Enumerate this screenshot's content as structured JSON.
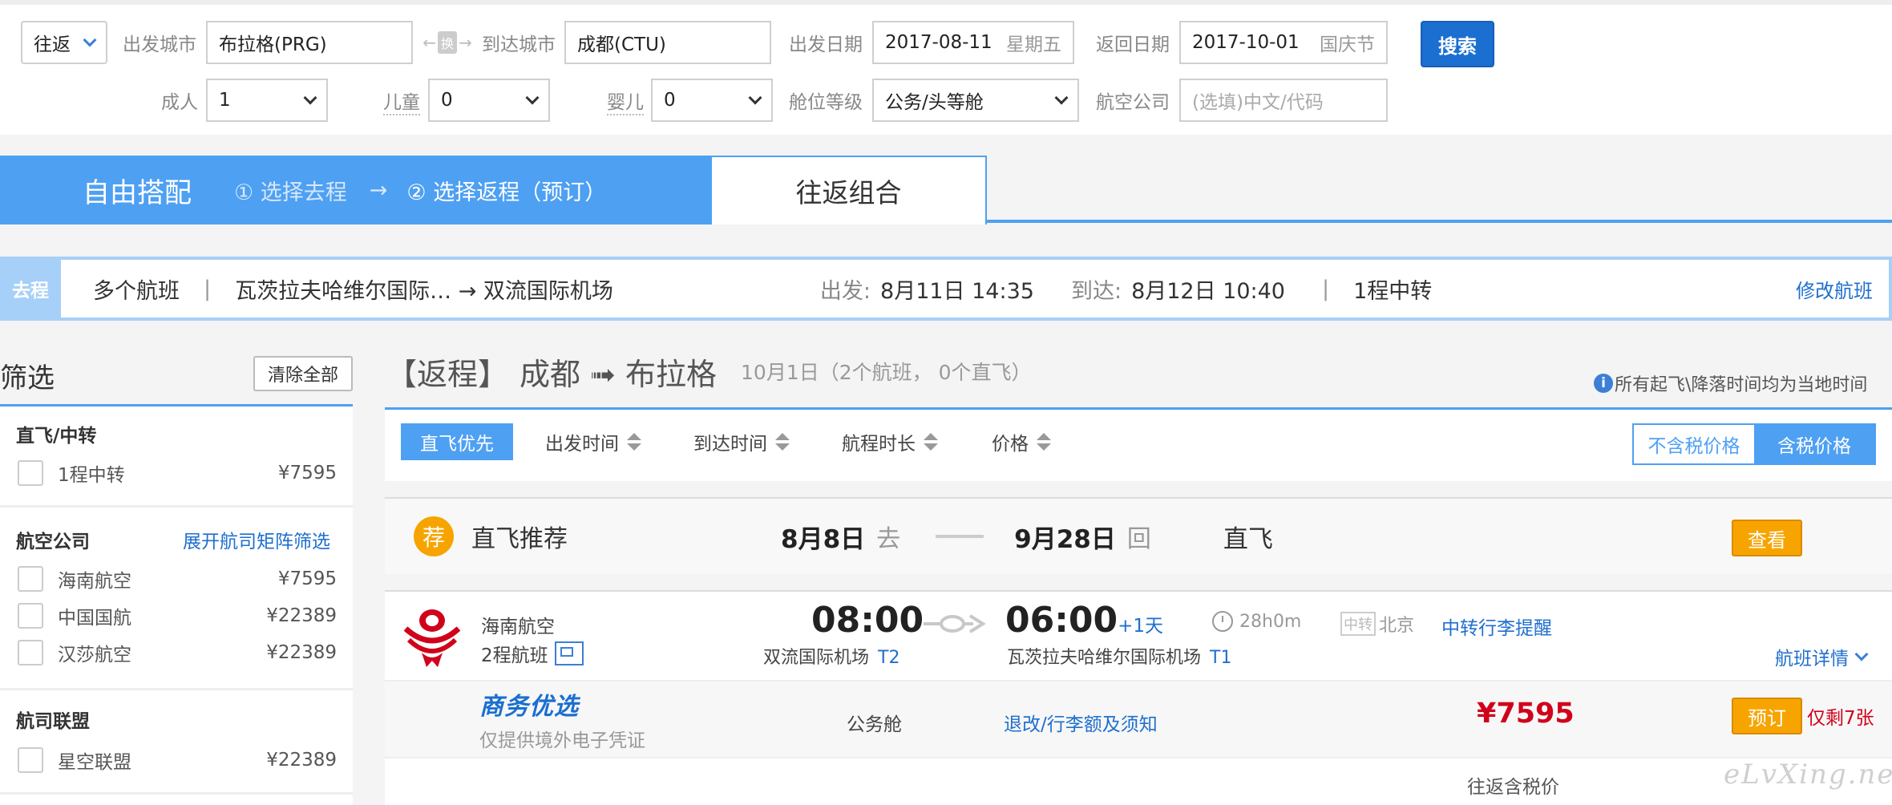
{
  "search": {
    "trip_type": "往返",
    "depart_city_label": "出发城市",
    "depart_city": "布拉格(PRG)",
    "swap": "换",
    "arrive_city_label": "到达城市",
    "arrive_city": "成都(CTU)",
    "depart_date_label": "出发日期",
    "depart_date": "2017-08-11",
    "depart_weekday": "星期五",
    "return_date_label": "返回日期",
    "return_date": "2017-10-01",
    "return_note": "国庆节",
    "search_button": "搜索",
    "adult_label": "成人",
    "adult_value": "1",
    "child_label": "儿童",
    "child_value": "0",
    "infant_label": "婴儿",
    "infant_value": "0",
    "cabin_label": "舱位等级",
    "cabin_value": "公务/头等舱",
    "airline_label": "航空公司",
    "airline_placeholder": "(选填)中文/代码"
  },
  "mode_tabs": {
    "free_combo": "自由搭配",
    "step1": "① 选择去程",
    "arrow": "→",
    "step2": "② 选择返程（预订）",
    "round_combo": "往返组合"
  },
  "outbound": {
    "tag": "去程",
    "flights": "多个航班",
    "sep": "|",
    "route": "瓦茨拉夫哈维尔国际… → 双流国际机场",
    "depart_label": "出发:",
    "depart_time": "8月11日 14:35",
    "arrive_label": "到达:",
    "arrive_time": "8月12日 10:40",
    "stops": "1程中转",
    "modify": "修改航班"
  },
  "filter": {
    "title": "筛选",
    "clear": "清除全部",
    "direct_title": "直飞/中转",
    "direct_items": [
      {
        "label": "1程中转",
        "price": "¥7595"
      }
    ],
    "airline_title": "航空公司",
    "airline_expand": "展开航司矩阵筛选",
    "airline_items": [
      {
        "label": "海南航空",
        "price": "¥7595"
      },
      {
        "label": "中国国航",
        "price": "¥22389"
      },
      {
        "label": "汉莎航空",
        "price": "¥22389"
      }
    ],
    "alliance_title": "航司联盟",
    "alliance_items": [
      {
        "label": "星空联盟",
        "price": "¥22389"
      }
    ]
  },
  "results": {
    "heading_tag": "【返程】",
    "heading_route": "成都 ➟ 布拉格",
    "heading_sub": "10月1日（2个航班， 0个直飞）",
    "time_note": "所有起飞\\降落时间均为当地时间",
    "sort": [
      "直飞优先",
      "出发时间",
      "到达时间",
      "航程时长",
      "价格"
    ],
    "price_toggle": {
      "exclude_tax": "不含税价格",
      "include_tax": "含税价格"
    },
    "recommend": {
      "badge": "荐",
      "title": "直飞推荐",
      "go_date": "8月8日",
      "go_tag": "去",
      "back_date": "9月28日",
      "back_tag": "回",
      "type": "直飞",
      "view": "查看"
    },
    "flight": {
      "airline": "海南航空",
      "legs": "2程航班",
      "dep_time": "08:00",
      "dep_airport": "双流国际机场",
      "dep_terminal": "T2",
      "arr_time": "06:00",
      "arr_plus": "+1天",
      "arr_airport": "瓦茨拉夫哈维尔国际机场",
      "arr_terminal": "T1",
      "duration": "28h0m",
      "transfer_tag": "中转",
      "transfer_city": "北京",
      "transfer_reminder": "中转行李提醒",
      "details": "航班详情",
      "promo": "商务优选",
      "promo_note": "仅提供境外电子凭证",
      "cabin": "公务舱",
      "rules": "退改/行李额及须知",
      "price": "¥7595",
      "book": "预订",
      "remaining": "仅剩7张",
      "tax_note": "往返含税价"
    }
  },
  "watermark": "eLvXing.net",
  "colors": {
    "accent_blue": "#4ea0f2",
    "price_red": "#d0021b",
    "orange": "#f7a400"
  }
}
